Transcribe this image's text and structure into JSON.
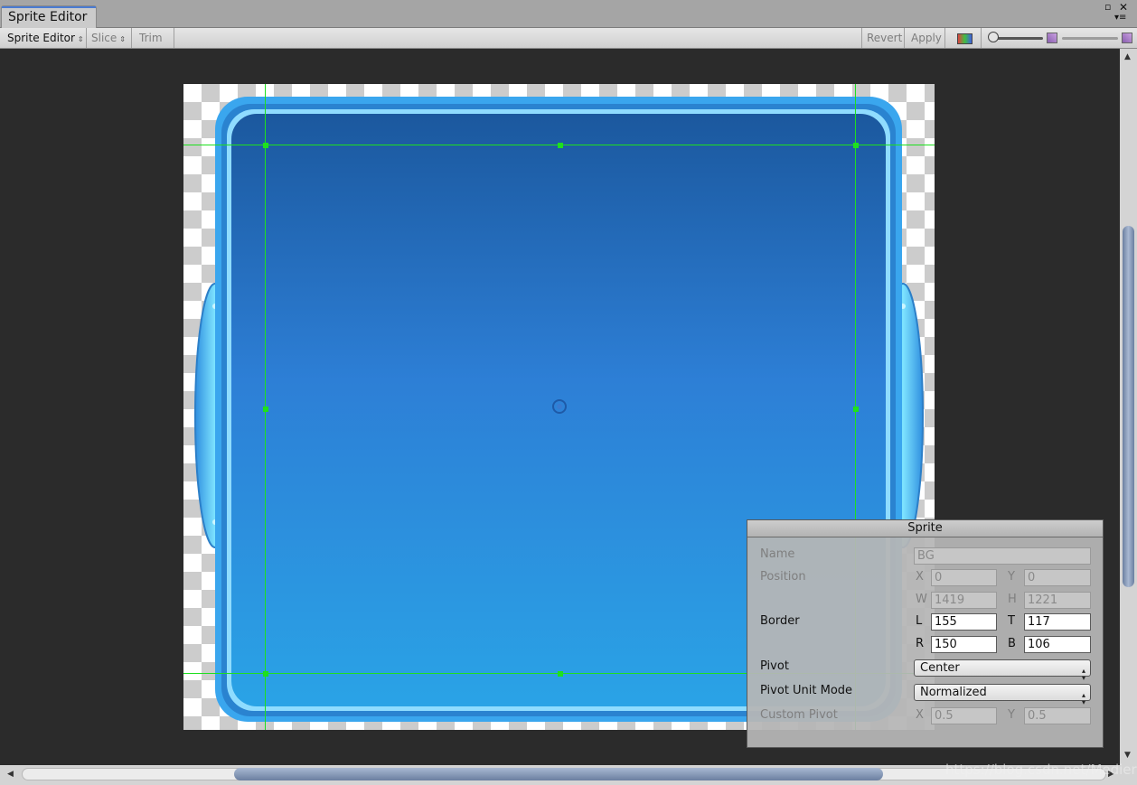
{
  "window": {
    "tab_label": "Sprite Editor",
    "maximize_glyph": "▫",
    "close_glyph": "✕",
    "menu_glyph": "▾≡"
  },
  "toolbar": {
    "mode_label": "Sprite Editor",
    "slice_label": "Slice",
    "trim_label": "Trim",
    "revert_label": "Revert",
    "apply_label": "Apply",
    "dropdown_arrow": "⇕"
  },
  "sprite_panel": {
    "title": "Sprite",
    "name_label": "Name",
    "name_value": "BG",
    "position_label": "Position",
    "x_label": "X",
    "x_value": "0",
    "y_label": "Y",
    "y_value": "0",
    "w_label": "W",
    "w_value": "1419",
    "h_label": "H",
    "h_value": "1221",
    "border_label": "Border",
    "l_label": "L",
    "l_value": "155",
    "t_label": "T",
    "t_value": "117",
    "r_label": "R",
    "r_value": "150",
    "b_label": "B",
    "b_value": "106",
    "pivot_label": "Pivot",
    "pivot_value": "Center",
    "pivot_unit_label": "Pivot Unit Mode",
    "pivot_unit_value": "Normalized",
    "custom_pivot_label": "Custom Pivot",
    "cx_label": "X",
    "cx_value": "0.5",
    "cy_label": "Y",
    "cy_value": "0.5"
  },
  "watermark": "https://blog.csdn.net/Mediery",
  "colors": {
    "guide": "#1ee01e",
    "sprite_top": "#1b589e",
    "sprite_bottom": "#2aa3e6",
    "frame": "#3aa6ee",
    "canvas_bg": "#2b2b2b",
    "tab_accent": "#4a7bd1"
  }
}
